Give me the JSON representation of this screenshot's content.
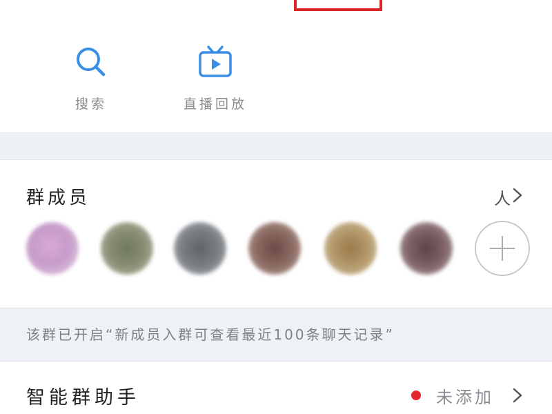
{
  "colors": {
    "accent": "#3a8ee6",
    "highlight_box": "#d9262a",
    "unread_dot": "#e3262d",
    "separator": "#edf1f5"
  },
  "quick_actions": [
    {
      "label": "搜索",
      "icon": "search-icon"
    },
    {
      "label": "直播回放",
      "icon": "live-replay-icon"
    }
  ],
  "members": {
    "title": "群成员",
    "count_suffix": "人",
    "add_icon": "plus-icon",
    "chevron_icon": "chevron-right-icon"
  },
  "notice": {
    "text": "该群已开启“新成员入群可查看最近100条聊天记录”"
  },
  "assistant": {
    "title": "智能群助手",
    "status": "未添加",
    "chevron_icon": "chevron-right-icon"
  }
}
